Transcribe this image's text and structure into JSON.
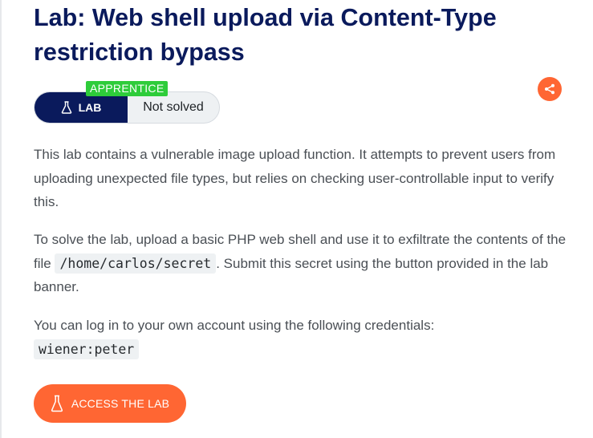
{
  "lab": {
    "title": "Lab: Web shell upload via Content-Type restriction bypass",
    "level": "APPRENTICE",
    "type_label": "LAB",
    "status": "Not solved"
  },
  "description": {
    "p1": "This lab contains a vulnerable image upload function. It attempts to prevent users from uploading unexpected file types, but relies on checking user-controllable input to verify this.",
    "p2_before": "To solve the lab, upload a basic PHP web shell and use it to exfiltrate the contents of the file ",
    "p2_code": "/home/carlos/secret",
    "p2_after": ". Submit this secret using the button provided in the lab banner.",
    "p3_text": "You can log in to your own account using the following credentials:",
    "p3_code": "wiener:peter"
  },
  "actions": {
    "access_label": "ACCESS THE LAB"
  },
  "icons": {
    "lab": "flask-icon",
    "share": "share-icon",
    "access": "flask-icon"
  },
  "colors": {
    "brand_navy": "#0a1a5c",
    "accent_orange": "#ff6633",
    "level_green": "#2ecc3a",
    "text_gray": "#4a4f55",
    "code_bg": "#eef1f3"
  }
}
